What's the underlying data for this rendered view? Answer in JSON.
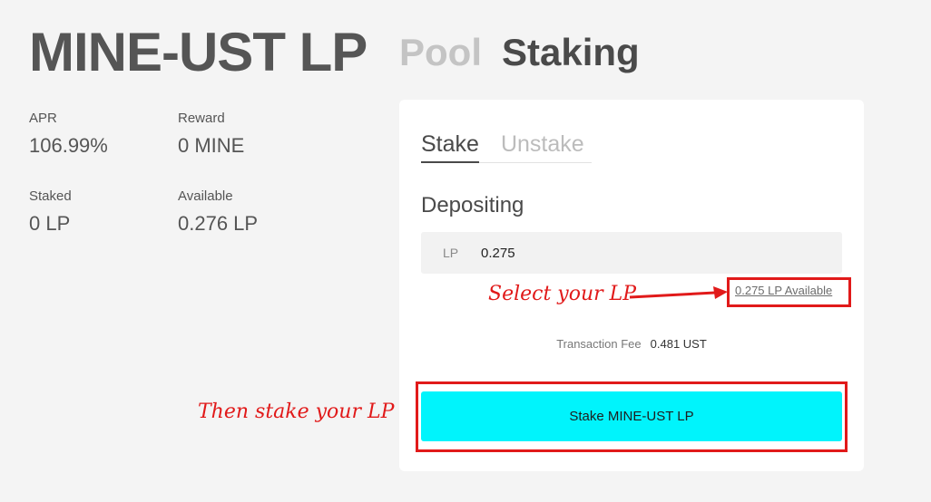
{
  "header": {
    "title": "MINE-UST LP",
    "tabs": [
      {
        "label": "Pool",
        "active": false
      },
      {
        "label": "Staking",
        "active": true
      }
    ]
  },
  "stats": {
    "apr": {
      "label": "APR",
      "value": "106.99%"
    },
    "reward": {
      "label": "Reward",
      "value": "0 MINE"
    },
    "staked": {
      "label": "Staked",
      "value": "0 LP"
    },
    "available": {
      "label": "Available",
      "value": "0.276 LP"
    }
  },
  "card": {
    "tabs": [
      {
        "label": "Stake",
        "active": true
      },
      {
        "label": "Unstake",
        "active": false
      }
    ],
    "section_title": "Depositing",
    "input": {
      "unit": "LP",
      "value": "0.275"
    },
    "available_link": "0.275 LP Available",
    "fee": {
      "label": "Transaction Fee",
      "value": "0.481 UST"
    },
    "stake_button": "Stake MINE-UST LP"
  },
  "annotations": {
    "select_text": "Select your LP",
    "stake_text": "Then stake your LP",
    "color": "#e11a1a"
  },
  "colors": {
    "background": "#f4f4f4",
    "button": "#00f4fc",
    "annotation": "#e11a1a"
  }
}
